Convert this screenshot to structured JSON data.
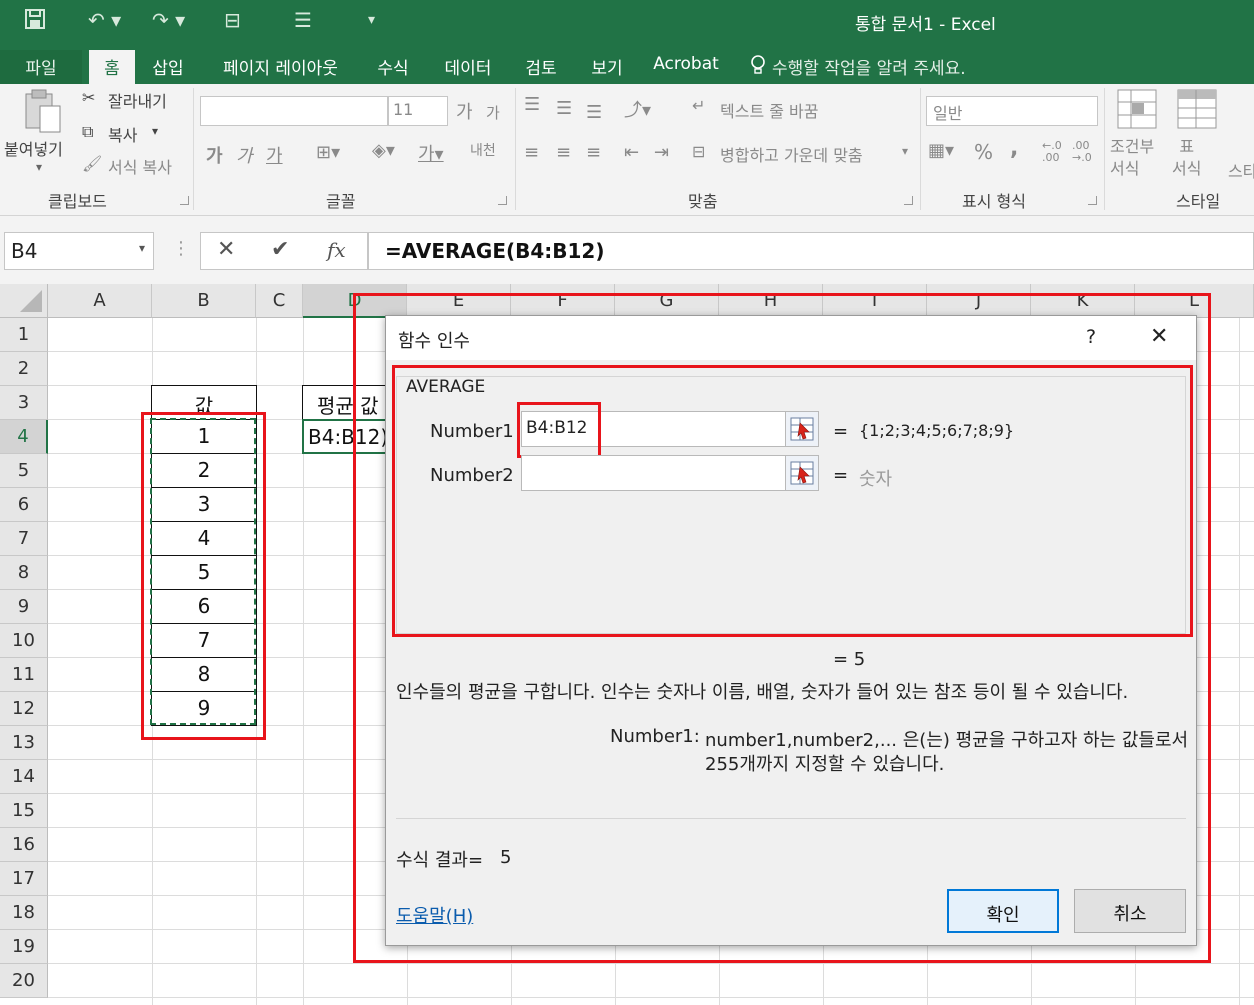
{
  "window": {
    "title": "통합 문서1 - Excel"
  },
  "ribbon_tabs": [
    "파일",
    "홈",
    "삽입",
    "페이지 레이아웃",
    "수식",
    "데이터",
    "검토",
    "보기",
    "Acrobat"
  ],
  "tell_me": "수행할 작업을 알려 주세요.",
  "ribbon": {
    "clipboard": {
      "paste": "붙여넣기",
      "cut": "잘라내기",
      "copy": "복사",
      "format_painter": "서식 복사",
      "group": "클립보드"
    },
    "font": {
      "size": "11",
      "bold": "가",
      "italic": "가",
      "underline": "가",
      "grow": "가",
      "shrink": "가",
      "phonetic": "내천",
      "group": "글꼴"
    },
    "alignment": {
      "wrap_text": "텍스트 줄 바꿈",
      "merge_center": "병합하고 가운데 맞춤",
      "group": "맞춤"
    },
    "number": {
      "format": "일반",
      "percent": "%",
      "comma": ",",
      "inc_decimal": "←.0\n.00",
      "dec_decimal": ".00\n→.0",
      "group": "표시 형식"
    },
    "styles": {
      "conditional": "조건부\n서식",
      "table": "표\n서식",
      "cell_styles": "스타",
      "group": "스타일"
    }
  },
  "formula_bar": {
    "name_box": "B4",
    "formula": "=AVERAGE(B4:B12)",
    "fx": "fx"
  },
  "columns": [
    "A",
    "B",
    "C",
    "D",
    "E",
    "F",
    "G",
    "H",
    "I",
    "J",
    "K",
    "L"
  ],
  "rows": [
    "1",
    "2",
    "3",
    "4",
    "5",
    "6",
    "7",
    "8",
    "9",
    "10",
    "11",
    "12",
    "13",
    "14",
    "15",
    "16",
    "17",
    "18",
    "19",
    "20"
  ],
  "cells": {
    "b3": "값",
    "d3": "평균 값",
    "d4": "B4:B12)",
    "b_values": [
      "1",
      "2",
      "3",
      "4",
      "5",
      "6",
      "7",
      "8",
      "9"
    ]
  },
  "dialog": {
    "title": "함수 인수",
    "help_q": "?",
    "close": "✕",
    "function_name": "AVERAGE",
    "arg1_label": "Number1",
    "arg1_value": "B4:B12",
    "arg1_eq": "=",
    "arg1_result": "{1;2;3;4;5;6;7;8;9}",
    "arg2_label": "Number2",
    "arg2_eq": "=",
    "arg2_hint": "숫자",
    "result_eq": "=  5",
    "description": "인수들의 평균을 구합니다. 인수는 숫자나 이름, 배열, 숫자가 들어 있는 참조 등이 될 수 있습니다.",
    "arg_help_label": "Number1:",
    "arg_help_line1": "number1,number2,... 은(는) 평균을 구하고자 하는 값들로서",
    "arg_help_line2": "255개까지 지정할 수 있습니다.",
    "formula_result_label": "수식 결과=",
    "formula_result_value": "5",
    "help_link": "도움말(H)",
    "ok": "확인",
    "cancel": "취소"
  },
  "colors": {
    "excel_green": "#217346",
    "highlight_red": "#e8141b",
    "selection_green": "#217346"
  }
}
